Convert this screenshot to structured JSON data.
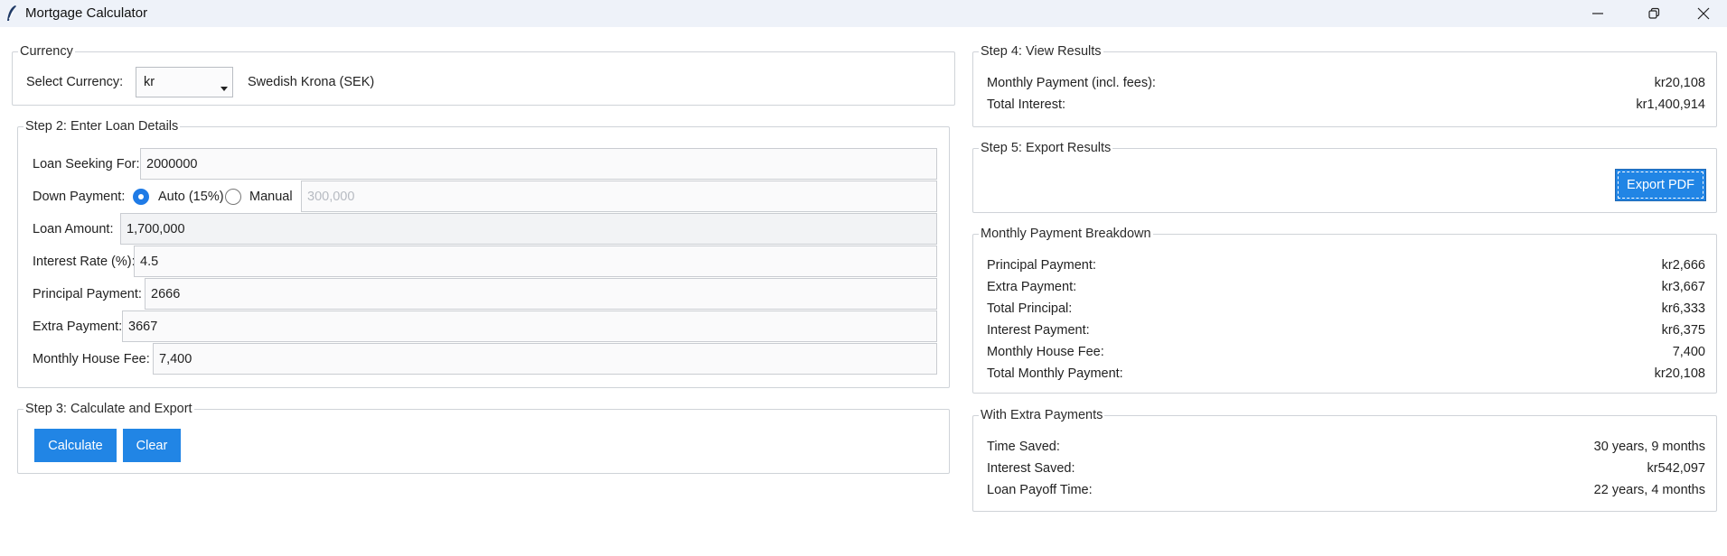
{
  "window": {
    "title": "Mortgage Calculator",
    "app_icon": "feather-icon",
    "controls": [
      "minimize-icon",
      "restore-icon",
      "close-icon"
    ]
  },
  "currency": {
    "group_label": "Currency",
    "select_label": "Select Currency:",
    "selected": "kr",
    "currency_name": "Swedish Krona (SEK)"
  },
  "loan": {
    "group_label": "Step 2: Enter Loan Details",
    "seeking_label": "Loan Seeking For:",
    "seeking_value": "2000000",
    "down_label": "Down Payment:",
    "auto_label": "Auto (15%)",
    "manual_label": "Manual",
    "down_mode": "auto",
    "down_value": "300,000",
    "amount_label": "Loan Amount:",
    "amount_value": "1,700,000",
    "rate_label": "Interest Rate (%):",
    "rate_value": "4.5",
    "principal_label": "Principal Payment:",
    "principal_value": "2666",
    "extra_label": "Extra Payment:",
    "extra_value": "3667",
    "fee_label": "Monthly House Fee:",
    "fee_value": "7,400"
  },
  "actions": {
    "group_label": "Step 3: Calculate and Export",
    "calculate_label": "Calculate",
    "clear_label": "Clear"
  },
  "results": {
    "group_label": "Step 4: View Results",
    "monthly_label": "Monthly Payment (incl. fees):",
    "monthly_value": "kr20,108",
    "interest_label": "Total Interest:",
    "interest_value": "kr1,400,914"
  },
  "export": {
    "group_label": "Step 5: Export Results",
    "pdf_label": "Export PDF"
  },
  "breakdown": {
    "group_label": "Monthly Payment Breakdown",
    "rows": [
      {
        "label": "Principal Payment:",
        "value": "kr2,666"
      },
      {
        "label": "Extra Payment:",
        "value": "kr3,667"
      },
      {
        "label": "Total Principal:",
        "value": "kr6,333"
      },
      {
        "label": "Interest Payment:",
        "value": "kr6,375"
      },
      {
        "label": "Monthly House Fee:",
        "value": "7,400"
      },
      {
        "label": "Total Monthly Payment:",
        "value": "kr20,108"
      }
    ]
  },
  "extra_payments": {
    "group_label": "With Extra Payments",
    "rows": [
      {
        "label": "Time Saved:",
        "value": "30 years, 9 months"
      },
      {
        "label": "Interest Saved:",
        "value": "kr542,097"
      },
      {
        "label": "Loan Payoff Time:",
        "value": "22 years, 4 months"
      }
    ]
  },
  "colors": {
    "accent": "#2185e5",
    "titlebar": "#eef2f9",
    "border": "#cfd3d8"
  }
}
